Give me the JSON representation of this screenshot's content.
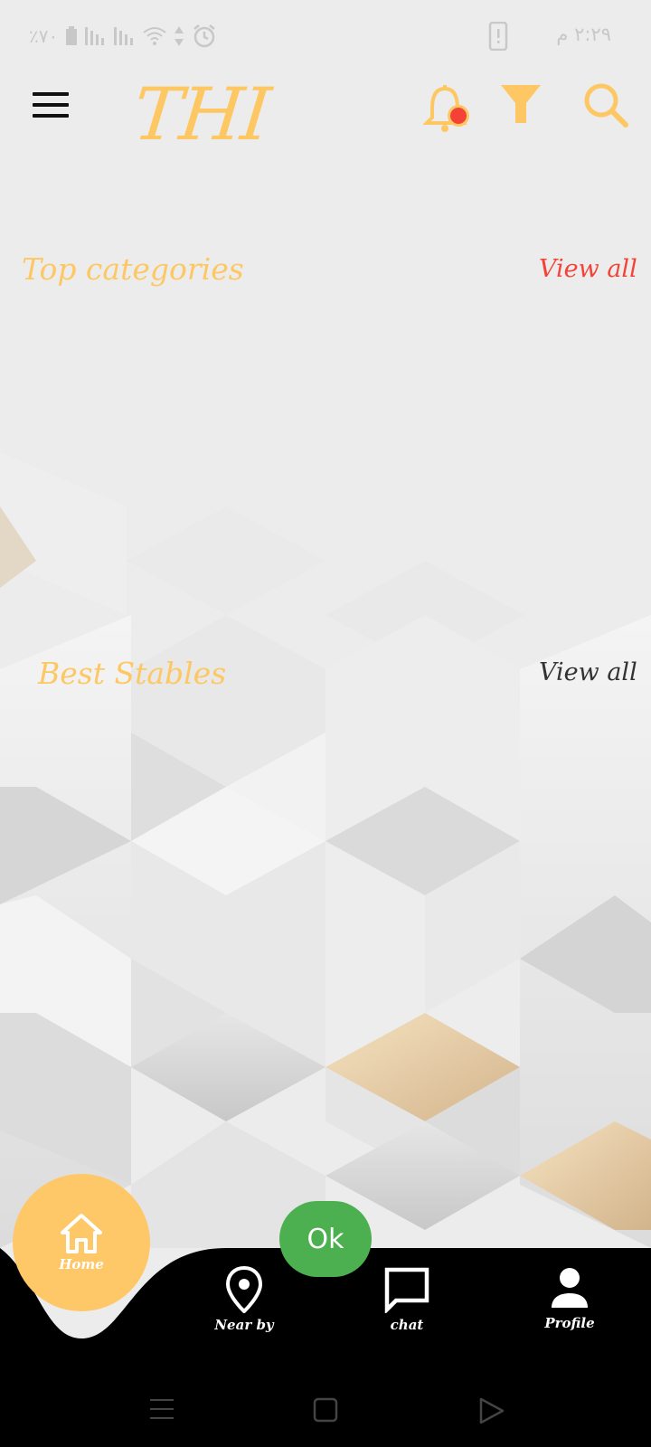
{
  "status_bar": {
    "battery": "٪٧٠",
    "time": "٢:٢٩ م",
    "icons": [
      "battery-icon",
      "signal-icon",
      "signal-icon",
      "wifi-icon",
      "data-arrows-icon",
      "alarm-icon",
      "phone-alert-icon"
    ]
  },
  "header": {
    "logo": "THI",
    "icons": [
      "menu-icon",
      "bell-icon",
      "filter-icon",
      "search-icon"
    ],
    "notification_dot_color": "#f44336"
  },
  "sections": {
    "top_categories": {
      "title": "Top categories",
      "view_all": "View all",
      "view_all_color": "#f44336"
    },
    "best_stables": {
      "title": "Best Stables",
      "view_all": "View all",
      "view_all_color": "#333333"
    }
  },
  "bottom_nav": {
    "home": "Home",
    "near_by": "Near by",
    "chat": "chat",
    "profile": "Profile",
    "ok": "Ok"
  },
  "colors": {
    "accent": "#fdc864",
    "ok_green": "#4caf50",
    "nav_bg": "#000000",
    "background": "#ececec"
  }
}
